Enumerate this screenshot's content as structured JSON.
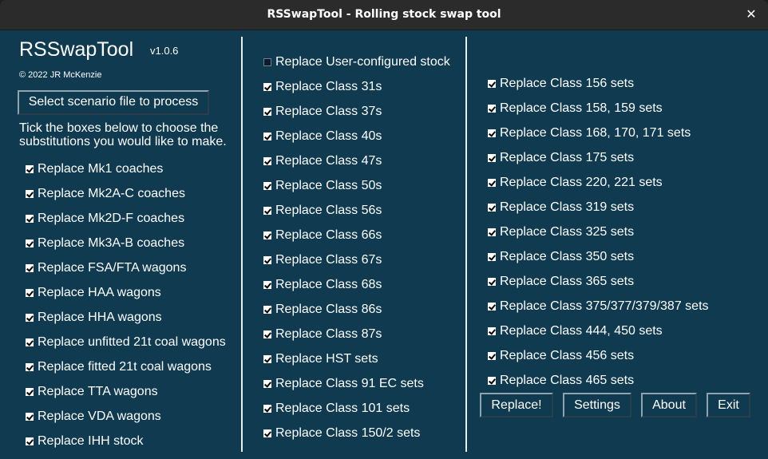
{
  "window": {
    "title": "RSSwapTool - Rolling stock swap tool",
    "close_glyph": "✕"
  },
  "header": {
    "app_name": "RSSwapTool",
    "version": "v1.0.6",
    "copyright": "© 2022 JR McKenzie"
  },
  "select_button_label": "Select scenario file to process",
  "instructions": "Tick the boxes below to choose the substitutions you would like to make.",
  "left_options": [
    {
      "label": "Replace Mk1 coaches",
      "checked": true
    },
    {
      "label": "Replace Mk2A-C coaches",
      "checked": true
    },
    {
      "label": "Replace Mk2D-F coaches",
      "checked": true
    },
    {
      "label": "Replace Mk3A-B coaches",
      "checked": true
    },
    {
      "label": "Replace FSA/FTA wagons",
      "checked": true
    },
    {
      "label": "Replace HAA wagons",
      "checked": true
    },
    {
      "label": "Replace HHA wagons",
      "checked": true
    },
    {
      "label": "Replace unfitted 21t coal wagons",
      "checked": true
    },
    {
      "label": "Replace fitted 21t coal wagons",
      "checked": true
    },
    {
      "label": "Replace TTA wagons",
      "checked": true
    },
    {
      "label": "Replace VDA wagons",
      "checked": true
    },
    {
      "label": "Replace IHH stock",
      "checked": true
    }
  ],
  "middle_options": [
    {
      "label": "Replace User-configured stock",
      "checked": false
    },
    {
      "label": "Replace Class 31s",
      "checked": true
    },
    {
      "label": "Replace Class 37s",
      "checked": true
    },
    {
      "label": "Replace Class 40s",
      "checked": true
    },
    {
      "label": "Replace Class 47s",
      "checked": true
    },
    {
      "label": "Replace Class 50s",
      "checked": true
    },
    {
      "label": "Replace Class 56s",
      "checked": true
    },
    {
      "label": "Replace Class 66s",
      "checked": true
    },
    {
      "label": "Replace Class 67s",
      "checked": true
    },
    {
      "label": "Replace Class 68s",
      "checked": true
    },
    {
      "label": "Replace Class 86s",
      "checked": true
    },
    {
      "label": "Replace Class 87s",
      "checked": true
    },
    {
      "label": "Replace HST sets",
      "checked": true
    },
    {
      "label": "Replace Class 91 EC sets",
      "checked": true
    },
    {
      "label": "Replace Class 101 sets",
      "checked": true
    },
    {
      "label": "Replace Class 150/2 sets",
      "checked": true
    }
  ],
  "right_options": [
    {
      "label": "Replace Class 156 sets",
      "checked": true
    },
    {
      "label": "Replace Class 158, 159 sets",
      "checked": true
    },
    {
      "label": "Replace Class 168, 170, 171 sets",
      "checked": true
    },
    {
      "label": "Replace Class 175 sets",
      "checked": true
    },
    {
      "label": "Replace Class 220, 221 sets",
      "checked": true
    },
    {
      "label": "Replace Class 319 sets",
      "checked": true
    },
    {
      "label": "Replace Class 325 sets",
      "checked": true
    },
    {
      "label": "Replace Class 350 sets",
      "checked": true
    },
    {
      "label": "Replace Class 365 sets",
      "checked": true
    },
    {
      "label": "Replace Class 375/377/379/387 sets",
      "checked": true
    },
    {
      "label": "Replace Class 444, 450 sets",
      "checked": true
    },
    {
      "label": "Replace Class 456 sets",
      "checked": true
    },
    {
      "label": "Replace Class 465 sets",
      "checked": true
    }
  ],
  "actions": {
    "replace_label": "Replace!",
    "settings_label": "Settings",
    "about_label": "About",
    "exit_label": "Exit"
  },
  "colors": {
    "background": "#0f3a50",
    "titlebar": "#2b2b2b",
    "text": "#ffffff"
  }
}
